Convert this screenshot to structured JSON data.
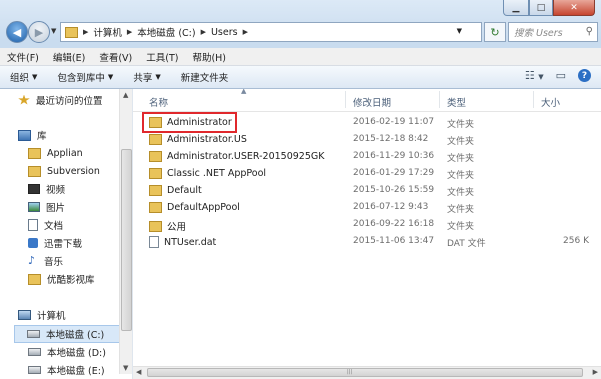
{
  "breadcrumbs": [
    "计算机",
    "本地磁盘 (C:)",
    "Users"
  ],
  "search": {
    "placeholder": "搜索 Users"
  },
  "menu": [
    "文件(F)",
    "编辑(E)",
    "查看(V)",
    "工具(T)",
    "帮助(H)"
  ],
  "toolbar": {
    "organize": "组织",
    "include_library": "包含到库中",
    "share": "共享",
    "new_folder": "新建文件夹"
  },
  "nav": {
    "recent": "最近访问的位置",
    "libraries": "库",
    "lib_items": [
      "Applian",
      "Subversion",
      "视频",
      "图片",
      "文档",
      "迅雷下载",
      "音乐",
      "优酷影视库"
    ],
    "computer": "计算机",
    "drives": [
      "本地磁盘 (C:)",
      "本地磁盘 (D:)",
      "本地磁盘 (E:)"
    ]
  },
  "columns": {
    "name": "名称",
    "modified": "修改日期",
    "type": "类型",
    "size": "大小"
  },
  "files": [
    {
      "name": "Administrator",
      "date": "2016-02-19 11:07",
      "type": "文件夹",
      "size": "",
      "kind": "folder"
    },
    {
      "name": "Administrator.US",
      "date": "2015-12-18 8:42",
      "type": "文件夹",
      "size": "",
      "kind": "folder"
    },
    {
      "name": "Administrator.USER-20150925GK",
      "date": "2016-11-29 10:36",
      "type": "文件夹",
      "size": "",
      "kind": "folder"
    },
    {
      "name": "Classic .NET AppPool",
      "date": "2016-01-29 17:29",
      "type": "文件夹",
      "size": "",
      "kind": "folder"
    },
    {
      "name": "Default",
      "date": "2015-10-26 15:59",
      "type": "文件夹",
      "size": "",
      "kind": "folder"
    },
    {
      "name": "DefaultAppPool",
      "date": "2016-07-12 9:43",
      "type": "文件夹",
      "size": "",
      "kind": "folder"
    },
    {
      "name": "公用",
      "date": "2016-09-22 16:18",
      "type": "文件夹",
      "size": "",
      "kind": "folder"
    },
    {
      "name": "NTUser.dat",
      "date": "2015-11-06 13:47",
      "type": "DAT 文件",
      "size": "256 K",
      "kind": "file"
    }
  ],
  "colors": {
    "highlight_box": "#e0282c",
    "folder": "#e9c35a",
    "chrome": "#c9dcef"
  }
}
